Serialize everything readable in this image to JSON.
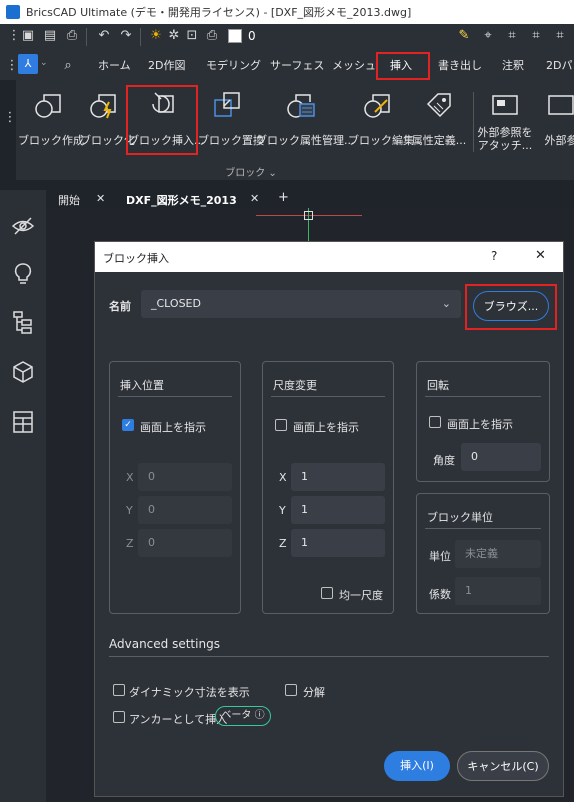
{
  "window": {
    "title": "BricsCAD Ultimate (デモ・開発用ライセンス) - [DXF_図形メモ_2013.dwg]"
  },
  "toolbar": {
    "layer_value": "0"
  },
  "ribbon_tabs": [
    "ホーム",
    "2D作図",
    "モデリング",
    "サーフェス",
    "メッシュ",
    "挿入",
    "書き出し",
    "注釈",
    "2Dパ"
  ],
  "ribbon": {
    "buttons": [
      "ブロック作成",
      "ブロック化",
      "ブロック挿入...",
      "ブロック置換",
      "ブロック属性管理...",
      "ブロック編集",
      "属性定義...",
      "外部参照を\nアタッチ...",
      "外部参"
    ],
    "group_label": "ブロック ⌄"
  },
  "doc_tabs": {
    "start": "開始",
    "active": "DXF_図形メモ_2013",
    "add": "+",
    "close": "✕"
  },
  "dialog": {
    "title": "ブロック挿入",
    "help": "?",
    "close": "✕",
    "name_label": "名前",
    "name_value": "_CLOSED",
    "browse_label": "ブラウズ...",
    "insertion": {
      "title": "挿入位置",
      "onscreen_label": "画面上を指示",
      "onscreen_checked": true,
      "x_label": "X",
      "x_value": "0",
      "y_label": "Y",
      "y_value": "0",
      "z_label": "Z",
      "z_value": "0"
    },
    "scale": {
      "title": "尺度変更",
      "onscreen_label": "画面上を指示",
      "onscreen_checked": false,
      "x_label": "X",
      "x_value": "1",
      "y_label": "Y",
      "y_value": "1",
      "z_label": "Z",
      "z_value": "1",
      "uniform_label": "均一尺度",
      "uniform_checked": false
    },
    "rotation": {
      "title": "回転",
      "onscreen_label": "画面上を指示",
      "onscreen_checked": false,
      "angle_label": "角度",
      "angle_value": "0"
    },
    "block_unit": {
      "title": "ブロック単位",
      "unit_label": "単位",
      "unit_value": "未定義",
      "factor_label": "係数",
      "factor_value": "1"
    },
    "advanced": {
      "title": "Advanced settings",
      "dynamic_dims_label": "ダイナミック寸法を表示",
      "explode_label": "分解",
      "anchor_label": "アンカーとして挿入",
      "beta_label": "ベータ ⓘ"
    },
    "insert_button": "挿入(I)",
    "cancel_button": "キャンセル(C)"
  },
  "colors": {
    "accent": "#2e7de1",
    "highlight_border": "#e32222",
    "beta_border": "#35c9a0"
  }
}
